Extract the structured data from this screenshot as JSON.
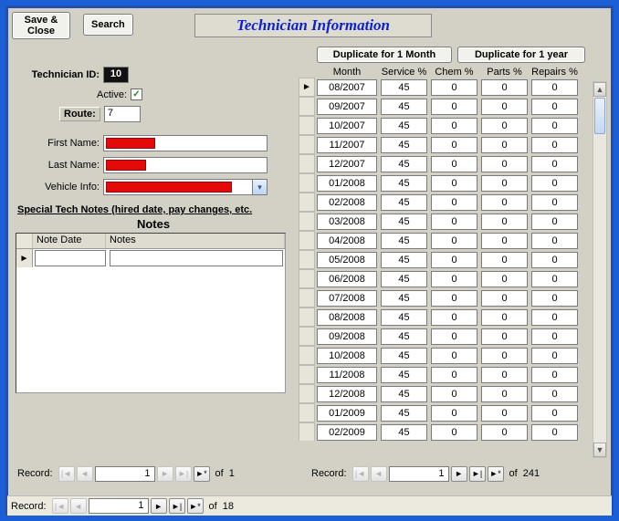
{
  "title": "Technician Information",
  "buttons": {
    "save_close": "Save & Close",
    "search": "Search",
    "dup_month": "Duplicate for 1 Month",
    "dup_year": "Duplicate for 1 year"
  },
  "labels": {
    "tech_id": "Technician ID:",
    "active": "Active:",
    "route": "Route:",
    "first_name": "First Name:",
    "last_name": "Last Name:",
    "vehicle_info": "Vehicle Info:",
    "special_notes": "Special Tech Notes (hired date, pay changes, etc.",
    "notes": "Notes",
    "note_date": "Note Date",
    "notes_col": "Notes",
    "record": "Record:",
    "of": "of"
  },
  "fields": {
    "tech_id": "10",
    "active": true,
    "route": "7",
    "first_name": "",
    "last_name": "",
    "vehicle_info": ""
  },
  "grid_headers": {
    "month": "Month",
    "service": "Service %",
    "chem": "Chem %",
    "parts": "Parts %",
    "repairs": "Repairs %"
  },
  "grid_rows": [
    {
      "month": "08/2007",
      "service": "45",
      "chem": "0",
      "parts": "0",
      "repairs": "0"
    },
    {
      "month": "09/2007",
      "service": "45",
      "chem": "0",
      "parts": "0",
      "repairs": "0"
    },
    {
      "month": "10/2007",
      "service": "45",
      "chem": "0",
      "parts": "0",
      "repairs": "0"
    },
    {
      "month": "11/2007",
      "service": "45",
      "chem": "0",
      "parts": "0",
      "repairs": "0"
    },
    {
      "month": "12/2007",
      "service": "45",
      "chem": "0",
      "parts": "0",
      "repairs": "0"
    },
    {
      "month": "01/2008",
      "service": "45",
      "chem": "0",
      "parts": "0",
      "repairs": "0"
    },
    {
      "month": "02/2008",
      "service": "45",
      "chem": "0",
      "parts": "0",
      "repairs": "0"
    },
    {
      "month": "03/2008",
      "service": "45",
      "chem": "0",
      "parts": "0",
      "repairs": "0"
    },
    {
      "month": "04/2008",
      "service": "45",
      "chem": "0",
      "parts": "0",
      "repairs": "0"
    },
    {
      "month": "05/2008",
      "service": "45",
      "chem": "0",
      "parts": "0",
      "repairs": "0"
    },
    {
      "month": "06/2008",
      "service": "45",
      "chem": "0",
      "parts": "0",
      "repairs": "0"
    },
    {
      "month": "07/2008",
      "service": "45",
      "chem": "0",
      "parts": "0",
      "repairs": "0"
    },
    {
      "month": "08/2008",
      "service": "45",
      "chem": "0",
      "parts": "0",
      "repairs": "0"
    },
    {
      "month": "09/2008",
      "service": "45",
      "chem": "0",
      "parts": "0",
      "repairs": "0"
    },
    {
      "month": "10/2008",
      "service": "45",
      "chem": "0",
      "parts": "0",
      "repairs": "0"
    },
    {
      "month": "11/2008",
      "service": "45",
      "chem": "0",
      "parts": "0",
      "repairs": "0"
    },
    {
      "month": "12/2008",
      "service": "45",
      "chem": "0",
      "parts": "0",
      "repairs": "0"
    },
    {
      "month": "01/2009",
      "service": "45",
      "chem": "0",
      "parts": "0",
      "repairs": "0"
    },
    {
      "month": "02/2009",
      "service": "45",
      "chem": "0",
      "parts": "0",
      "repairs": "0"
    }
  ],
  "nav": {
    "notes": {
      "current": "1",
      "total": "1"
    },
    "grid": {
      "current": "1",
      "total": "241"
    },
    "outer": {
      "current": "1",
      "total": "18"
    }
  },
  "icons": {
    "first": "|◄",
    "prev": "◄",
    "next": "►",
    "last": "►|",
    "new": "►*",
    "check": "✓",
    "row_current": "►",
    "dropdown": "▾",
    "up": "▲",
    "down": "▼"
  }
}
